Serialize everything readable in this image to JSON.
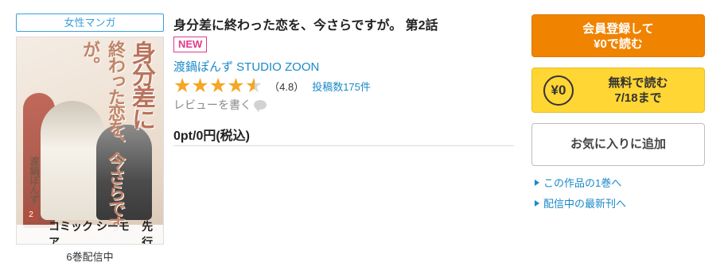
{
  "genre_tag": "女性マンガ",
  "cover": {
    "title_vertical_main": "身分差に",
    "title_vertical_sub": "終わった恋を、今さらですが。",
    "author_vertical": "渡鍋ぽんず",
    "volume_number": "2",
    "label_brand": "コミック シーモア",
    "label_advance": "先行"
  },
  "volume_count": "6巻配信中",
  "title": "身分差に終わった恋を、今さらですが。 第2話",
  "new_badge": "NEW",
  "author": "渡鍋ぽんず STUDIO ZOON",
  "rating": {
    "score_value": 4.8,
    "score_text": "（4.8）",
    "stars_filled": 4,
    "stars_half": 1,
    "review_count": "投稿数175件"
  },
  "write_review": "レビューを書く",
  "price": "0pt/0円(税込)",
  "buttons": {
    "register_line1": "会員登録して",
    "register_line2": "¥0で読む",
    "free_icon": "¥0",
    "free_line1": "無料で読む",
    "free_line2": "7/18まで",
    "favorite": "お気に入りに追加"
  },
  "links": {
    "first_volume": "この作品の1巻へ",
    "latest": "配信中の最新刊へ"
  },
  "colors": {
    "accent_blue": "#1a8ac8",
    "register_orange": "#f08300",
    "free_yellow": "#ffd633",
    "new_pink": "#e23a8a",
    "star": "#f5a623"
  }
}
